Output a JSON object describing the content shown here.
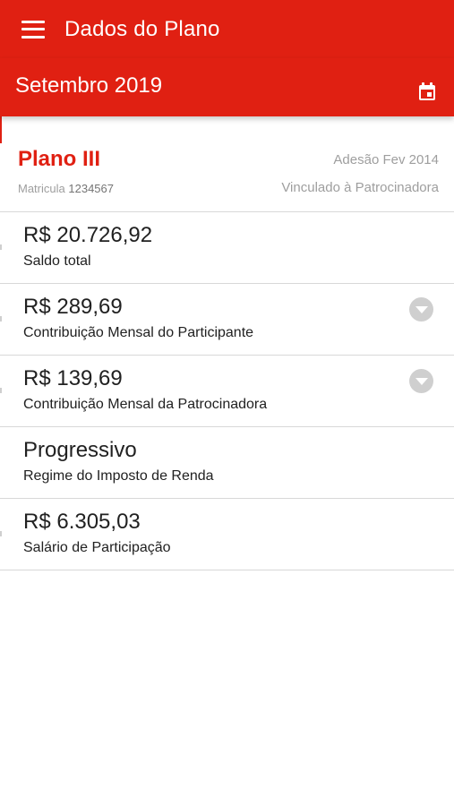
{
  "header": {
    "title": "Dados do Plano",
    "menu_icon": "hamburger-menu-icon"
  },
  "period": {
    "label": "Setembro 2019",
    "calendar_icon": "calendar-icon"
  },
  "plan": {
    "name": "Plano III",
    "adesao": "Adesão Fev 2014",
    "matricula_label": "Matricula",
    "matricula_value": "1234567",
    "vinculo": "Vinculado à Patrocinadora"
  },
  "items": [
    {
      "value": "R$ 20.726,92",
      "label": "Saldo total",
      "expandable": false
    },
    {
      "value": "R$ 289,69",
      "label": "Contribuição Mensal do Participante",
      "expandable": true
    },
    {
      "value": "R$ 139,69",
      "label": "Contribuição Mensal da Patrocinadora",
      "expandable": true
    },
    {
      "value": "Progressivo",
      "label": "Regime do Imposto de Renda",
      "expandable": false
    },
    {
      "value": "R$ 6.305,03",
      "label": "Salário de Participação",
      "expandable": false
    }
  ],
  "colors": {
    "brand": "#e02012",
    "muted_text": "#9e9e9e",
    "divider": "#d8d8d8"
  }
}
